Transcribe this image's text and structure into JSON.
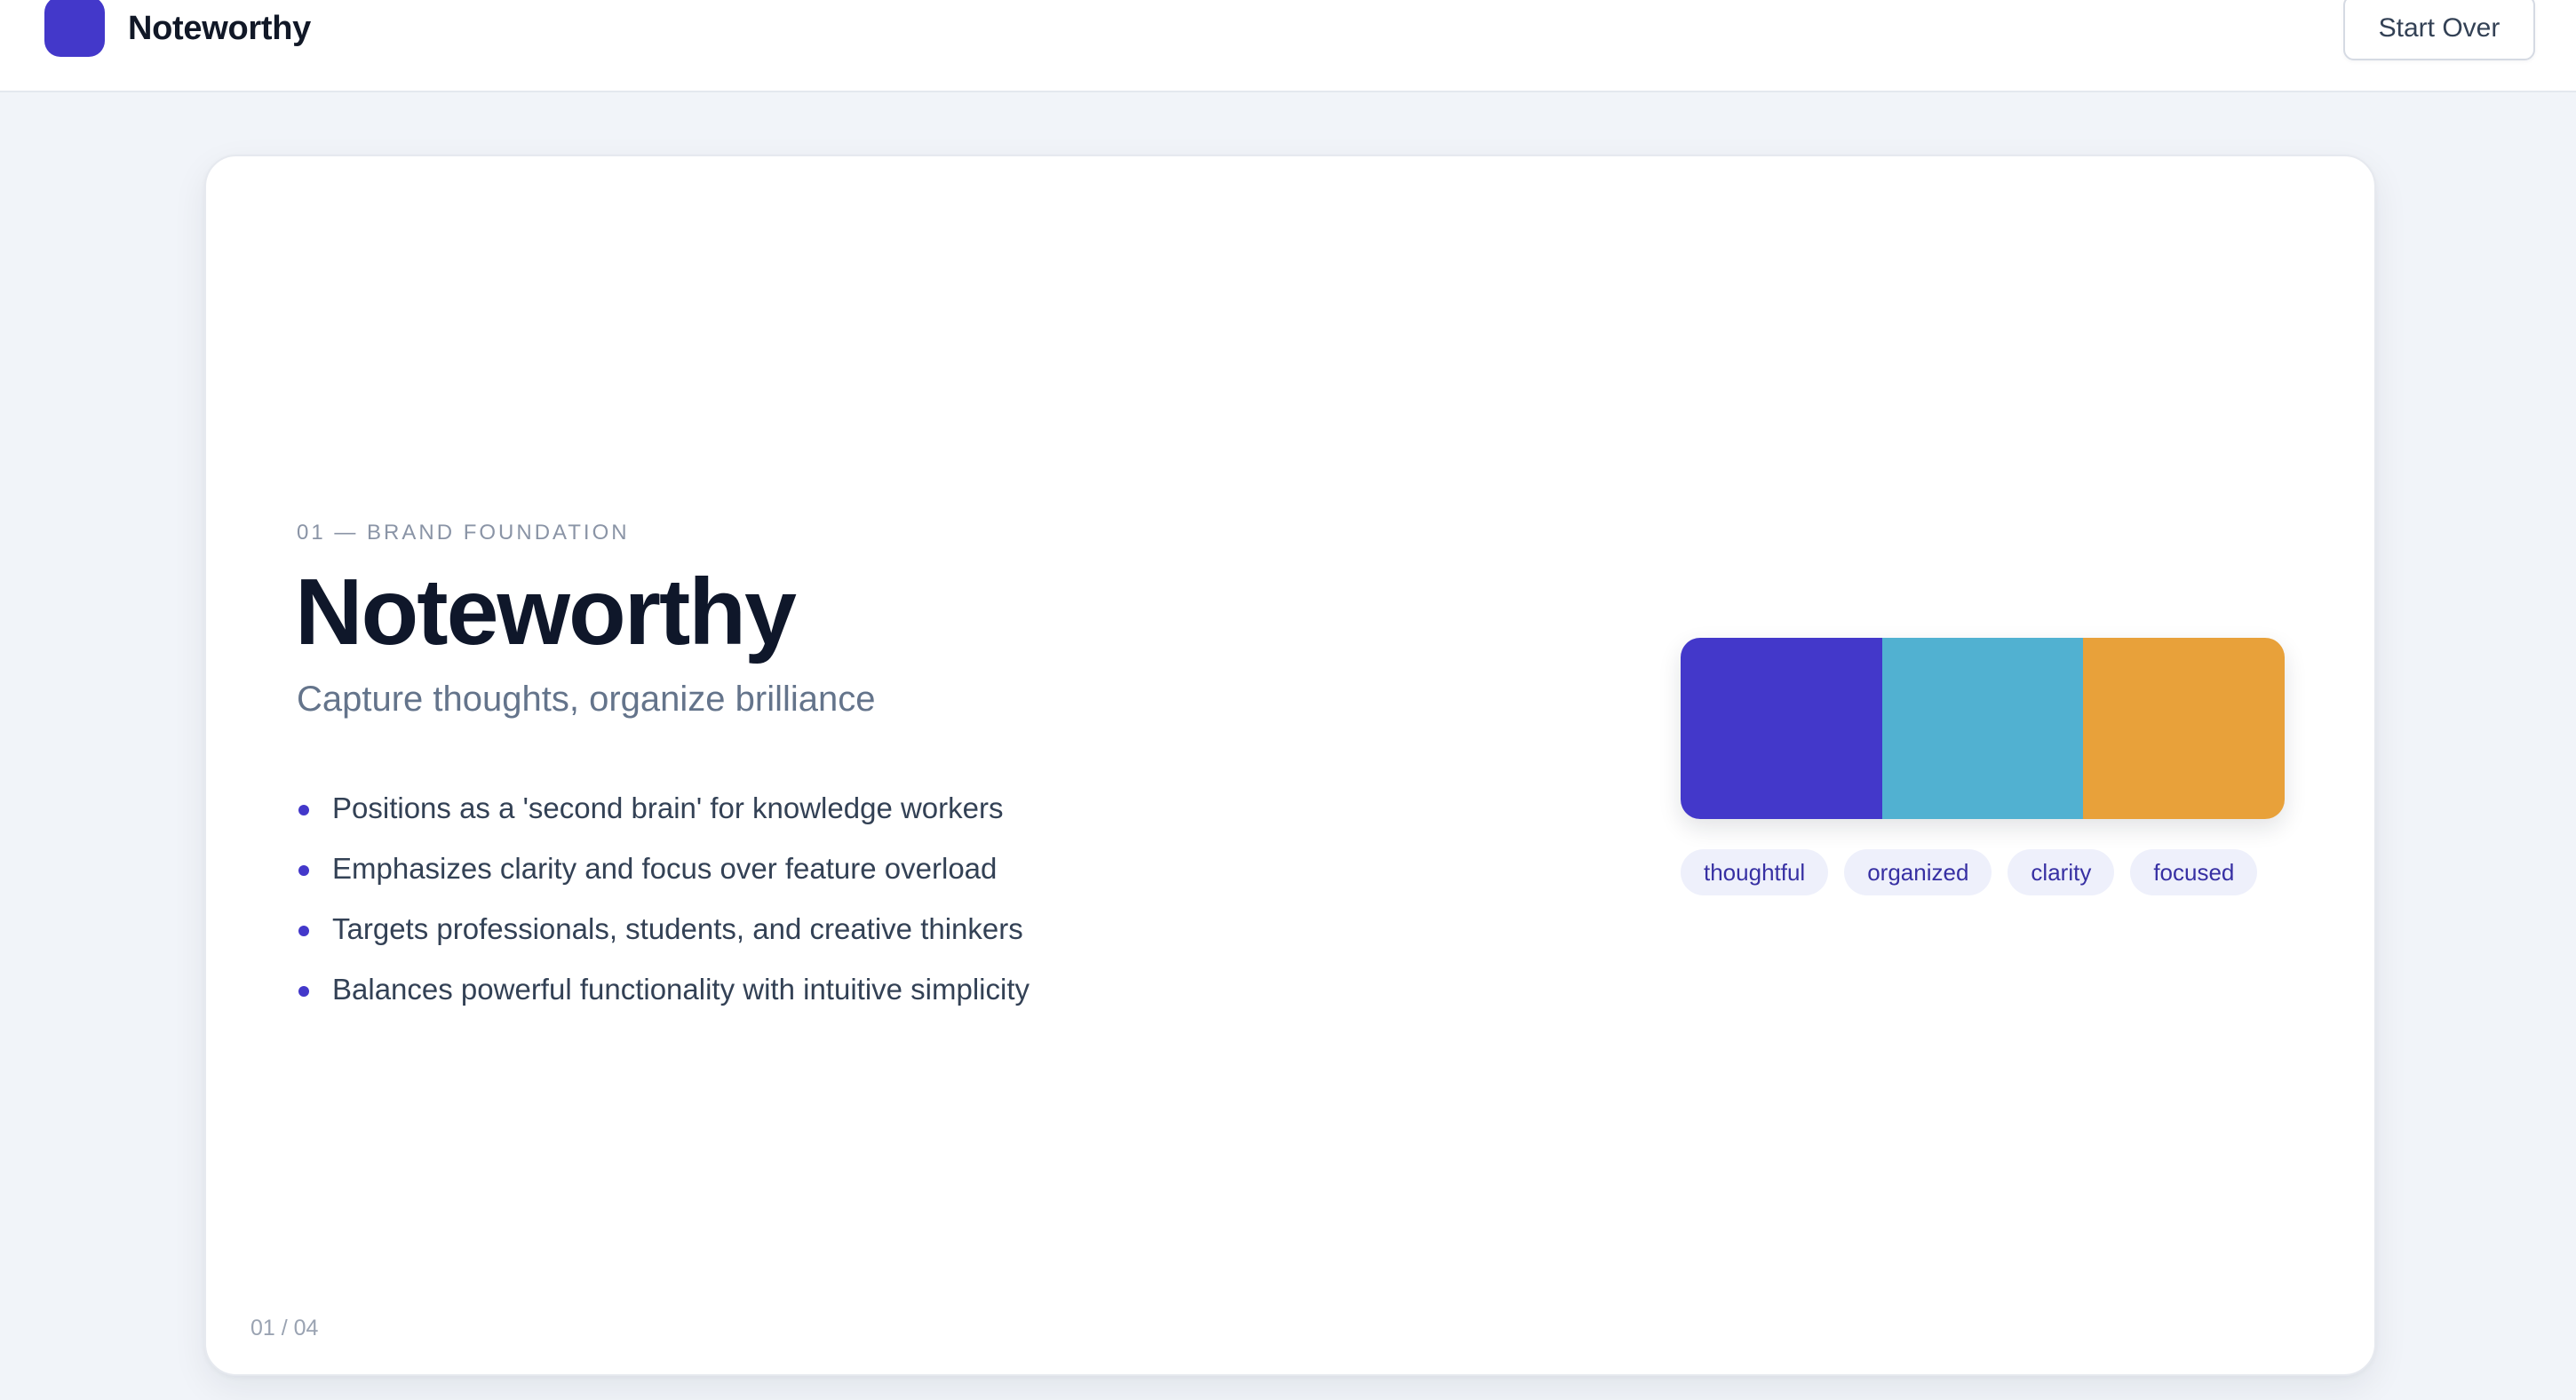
{
  "app": {
    "name": "Noteworthy",
    "start_over_label": "Start Over"
  },
  "slide": {
    "section_label": "01 — BRAND FOUNDATION",
    "title": "Noteworthy",
    "tagline": "Capture thoughts, organize brilliance",
    "bullets": [
      "Positions as a 'second brain' for knowledge workers",
      "Emphasizes clarity and focus over feature overload",
      "Targets professionals, students, and creative thinkers",
      "Balances powerful functionality with intuitive simplicity"
    ],
    "palette": [
      "#4338ca",
      "#51b1d1",
      "#e8a13a"
    ],
    "tags": [
      "thoughtful",
      "organized",
      "clarity",
      "focused"
    ],
    "page_indicator": "01 / 04"
  },
  "colors": {
    "accent": "#4338ca",
    "background": "#f1f4f9"
  },
  "icons": {
    "logo": "logo-mark-icon",
    "bullet": "bullet-dot-icon"
  }
}
